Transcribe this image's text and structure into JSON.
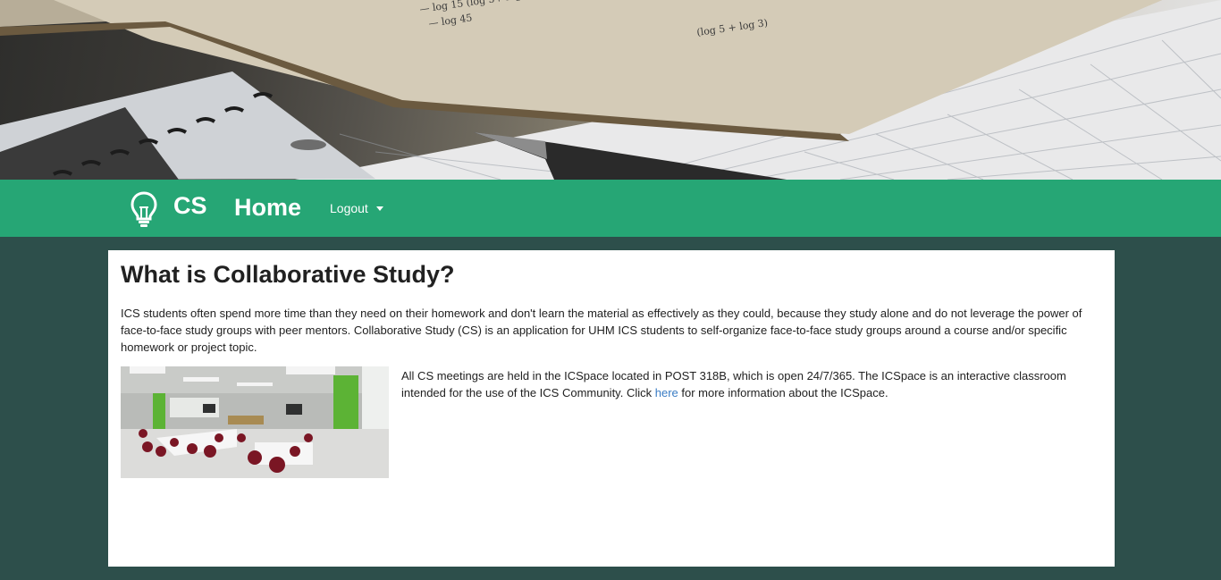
{
  "navbar": {
    "brand": "CS",
    "home_label": "Home",
    "logout_label": "Logout"
  },
  "content": {
    "title": "What is Collaborative Study?",
    "intro": "ICS students often spend more time than they need on their homework and don't learn the material as effectively as they could, because they study alone and do not leverage the power of face-to-face study groups with peer mentors. Collaborative Study (CS) is an application for UHM ICS students to self-organize face-to-face study groups around a course and/or specific homework or project topic.",
    "icspace_text_before": "All CS meetings are held in the ICSpace located in POST 318B, which is open 24/7/365. The ICSpace is an interactive classroom intended for the use of the ICS Community. Click ",
    "icspace_link": "here",
    "icspace_text_after": " for more information about the ICSpace."
  },
  "colors": {
    "navbar": "#26a675",
    "page_background": "#2d4f4b",
    "link": "#3a7cc4"
  },
  "icons": {
    "brand": "lightbulb-icon",
    "logout_menu": "caret-down-icon"
  }
}
